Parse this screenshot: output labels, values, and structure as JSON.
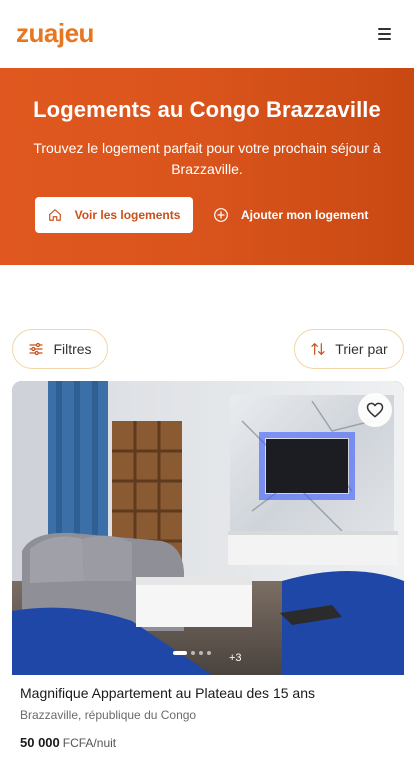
{
  "header": {
    "logo_text": "zuajeu",
    "brand_color": "#E8751F",
    "menu_icon": "hamburger-menu-icon"
  },
  "hero": {
    "title": "Logements au Congo Brazzaville",
    "subtitle": "Trouvez le logement parfait pour votre prochain séjour à Brazzaville.",
    "primary_button": {
      "label": "Voir les logements",
      "icon": "home-icon"
    },
    "secondary_button": {
      "label": "Ajouter mon logement",
      "icon": "plus-circle-icon"
    },
    "background_color": "#D9541C"
  },
  "toolbar": {
    "filters_label": "Filtres",
    "filters_icon": "sliders-icon",
    "sort_label": "Trier par",
    "sort_icon": "sort-arrows-icon"
  },
  "listing": {
    "title": "Magnifique Appartement au Plateau des 15 ans",
    "location": "Brazzaville, république du Congo",
    "price": "50 000",
    "price_unit": "FCFA/nuit",
    "extra_photos": "+3",
    "photo_count_dots": 4,
    "active_photo": 1,
    "favorite_icon": "heart-icon"
  }
}
